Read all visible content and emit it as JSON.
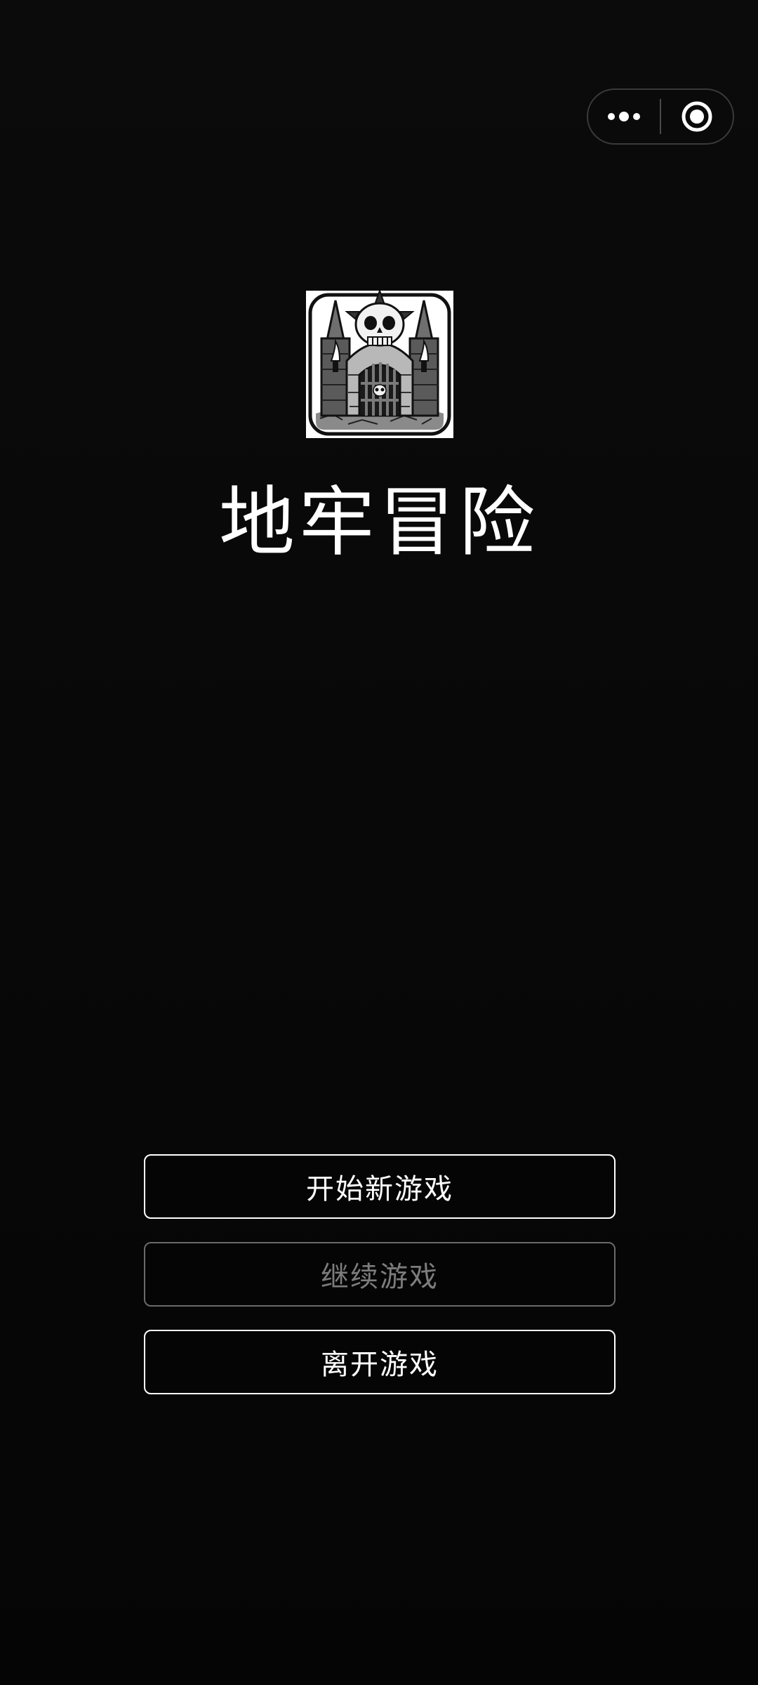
{
  "app": {
    "title": "地牢冒险"
  },
  "capsule": {
    "menu_icon": "more-dots-icon",
    "close_icon": "target-close-icon"
  },
  "logo": {
    "icon": "dungeon-skull-gate-icon"
  },
  "menu": {
    "new_game": "开始新游戏",
    "continue_game": "继续游戏",
    "quit_game": "离开游戏"
  },
  "colors": {
    "background": "#080808",
    "text": "#ffffff",
    "disabled_text": "#7c7c7c",
    "disabled_border": "#6a6a6a"
  }
}
